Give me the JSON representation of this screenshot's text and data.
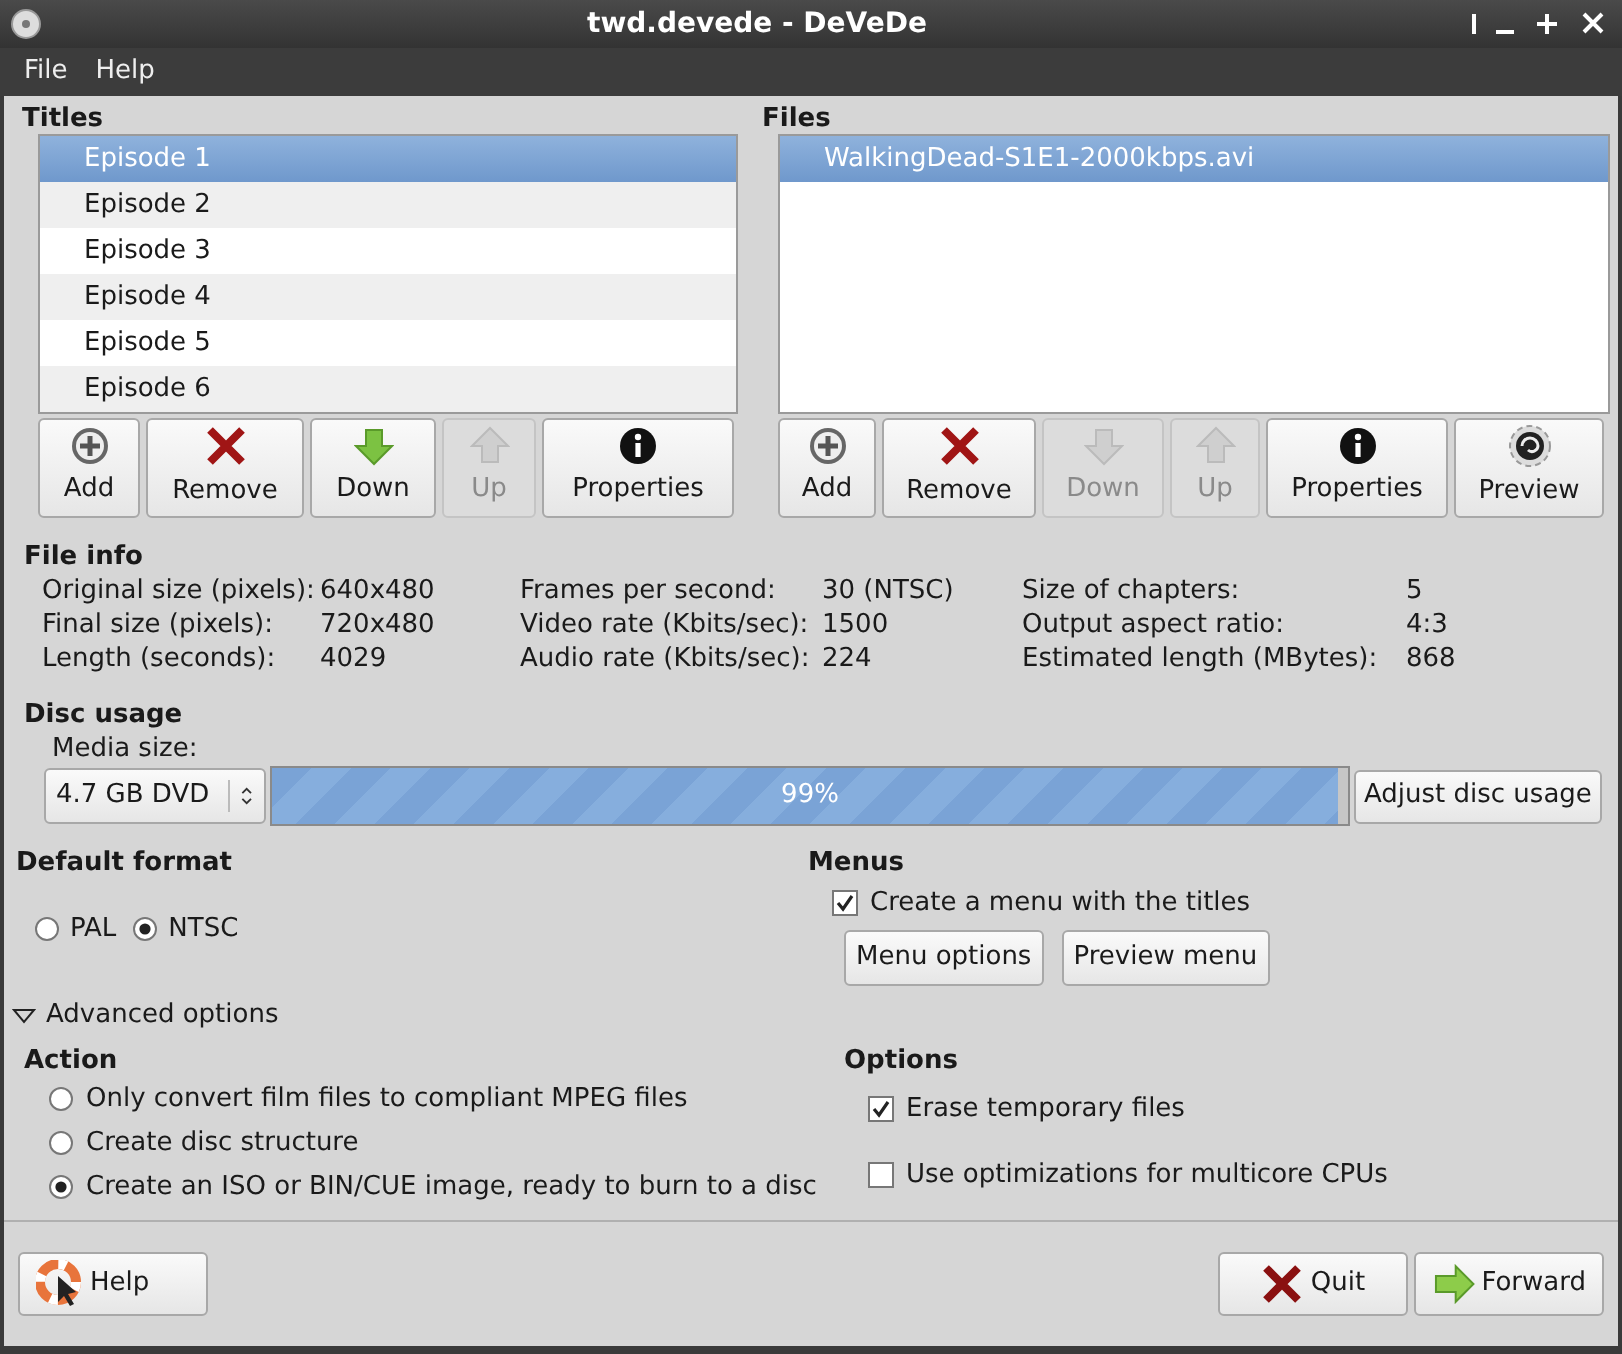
{
  "window": {
    "title": "twd.devede - DeVeDe"
  },
  "menu": [
    "File",
    "Help"
  ],
  "titles": {
    "heading": "Titles",
    "items": [
      {
        "label": "Episode 1",
        "selected": true
      },
      {
        "label": "Episode 2",
        "selected": false
      },
      {
        "label": "Episode 3",
        "selected": false
      },
      {
        "label": "Episode 4",
        "selected": false
      },
      {
        "label": "Episode 5",
        "selected": false
      },
      {
        "label": "Episode 6",
        "selected": false
      }
    ],
    "buttons": [
      {
        "kind": "add",
        "label": "Add",
        "disabled": false
      },
      {
        "kind": "remove",
        "label": "Remove",
        "disabled": false
      },
      {
        "kind": "down",
        "label": "Down",
        "disabled": false
      },
      {
        "kind": "up",
        "label": "Up",
        "disabled": true
      },
      {
        "kind": "properties",
        "label": "Properties",
        "disabled": false
      }
    ]
  },
  "files": {
    "heading": "Files",
    "items": [
      {
        "label": "WalkingDead-S1E1-2000kbps.avi",
        "selected": true
      }
    ],
    "buttons": [
      {
        "kind": "add",
        "label": "Add",
        "disabled": false
      },
      {
        "kind": "remove",
        "label": "Remove",
        "disabled": false
      },
      {
        "kind": "down",
        "label": "Down",
        "disabled": true
      },
      {
        "kind": "up",
        "label": "Up",
        "disabled": true
      },
      {
        "kind": "properties",
        "label": "Properties",
        "disabled": false
      },
      {
        "kind": "preview",
        "label": "Preview",
        "disabled": false
      }
    ]
  },
  "file_info": {
    "heading": "File info",
    "columns": [
      [
        {
          "label": "Original size (pixels):",
          "value": "640x480"
        },
        {
          "label": "Final size (pixels):",
          "value": "720x480"
        },
        {
          "label": "Length (seconds):",
          "value": "4029"
        }
      ],
      [
        {
          "label": "Frames per second:",
          "value": "30 (NTSC)"
        },
        {
          "label": "Video rate (Kbits/sec):",
          "value": "1500"
        },
        {
          "label": "Audio rate (Kbits/sec):",
          "value": "224"
        }
      ],
      [
        {
          "label": "Size of chapters:",
          "value": "5"
        },
        {
          "label": "Output aspect ratio:",
          "value": "4:3"
        },
        {
          "label": "Estimated length (MBytes):",
          "value": "868"
        }
      ]
    ]
  },
  "disc_usage": {
    "heading": "Disc usage",
    "media_label": "Media size:",
    "media": "4.7 GB DVD",
    "level": 0.99,
    "reading": "99%",
    "button": "Adjust disc usage"
  },
  "default_format": {
    "heading": "Default format",
    "options": [
      {
        "label": "PAL",
        "selected": false
      },
      {
        "label": "NTSC",
        "selected": true
      }
    ]
  },
  "menus": {
    "heading": "Menus",
    "checkbox": {
      "label": "Create a menu with the titles",
      "checked": true
    },
    "buttons": [
      "Menu options",
      "Preview menu"
    ]
  },
  "advanced": {
    "label": "Advanced options",
    "expanded": true
  },
  "action": {
    "heading": "Action",
    "options": [
      {
        "label": "Only convert film files to compliant MPEG files",
        "selected": false
      },
      {
        "label": "Create disc structure",
        "selected": false
      },
      {
        "label": "Create an ISO or BIN/CUE image, ready to burn to a disc",
        "selected": true
      }
    ]
  },
  "options": {
    "heading": "Options",
    "items": [
      {
        "label": "Erase temporary files",
        "checked": true
      },
      {
        "label": "Use optimizations for multicore CPUs",
        "checked": false
      }
    ]
  },
  "bottom_buttons": [
    {
      "kind": "help",
      "label": "Help"
    },
    {
      "kind": "quit",
      "label": "Quit"
    },
    {
      "kind": "forward",
      "label": "Forward"
    }
  ]
}
